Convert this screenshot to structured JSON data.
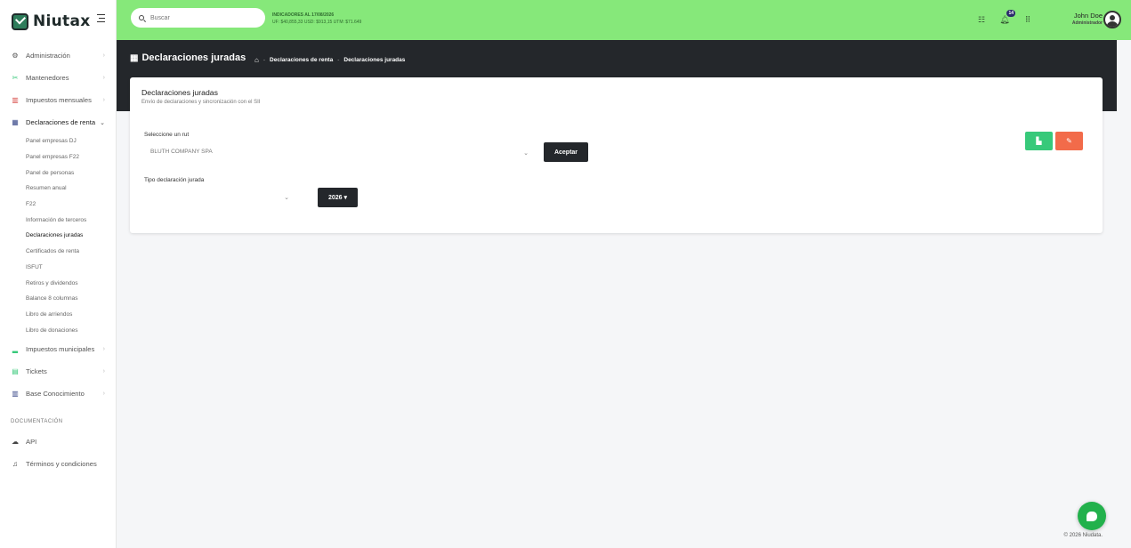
{
  "brand": {
    "name": "Niutax"
  },
  "search": {
    "placeholder": "Buscar"
  },
  "indicators": {
    "title": "INDICADORES AL 17/08/2026",
    "values": "UF: $40,855,33   USD: $913,15   UTM: $71.649"
  },
  "notifications": {
    "count": "14"
  },
  "user": {
    "name": "John Doe",
    "role": "Administrador"
  },
  "sidebar": {
    "items": [
      {
        "label": "Administración",
        "icon": "gear-icon"
      },
      {
        "label": "Mantenedores",
        "icon": "tools-icon"
      },
      {
        "label": "Impuestos mensuales",
        "icon": "books-icon"
      },
      {
        "label": "Declaraciones de renta",
        "icon": "building-icon"
      },
      {
        "label": "Impuestos municipales",
        "icon": "chart-icon"
      },
      {
        "label": "Tickets",
        "icon": "ticket-icon"
      },
      {
        "label": "Base Conocimiento",
        "icon": "library-icon"
      }
    ],
    "subitems": [
      "Panel empresas DJ",
      "Panel empresas F22",
      "Panel de personas",
      "Resumen anual",
      "F22",
      "Información de terceros",
      "Declaraciones juradas",
      "Certificados de renta",
      "ISFUT",
      "Retiros y dividendos",
      "Balance 8 columnas",
      "Libro de arriendos",
      "Libro de donaciones"
    ],
    "section_title": "DOCUMENTACIÓN",
    "docs": [
      {
        "label": "API",
        "icon": "cloud-icon"
      },
      {
        "label": "Términos y condiciones",
        "icon": "handshake-icon"
      }
    ]
  },
  "header": {
    "title": "Declaraciones juradas",
    "breadcrumb": [
      "Declaraciones de renta",
      "Declaraciones juradas"
    ]
  },
  "card": {
    "title": "Declaraciones juradas",
    "subtitle": "Envío de declaraciones y sincronización con el SII",
    "rut_label": "Seleccione un rut",
    "rut_value": "BLUTH COMPANY SPA",
    "accept_label": "Aceptar",
    "type_label": "Tipo declaración jurada",
    "type_value": "",
    "year_label": "2026 ▾"
  },
  "footer": {
    "text": "© 2026  Niudata."
  },
  "colors": {
    "topbar": "#86e87a",
    "dark": "#24272b",
    "green": "#37c97a",
    "red": "#f26b4a"
  }
}
